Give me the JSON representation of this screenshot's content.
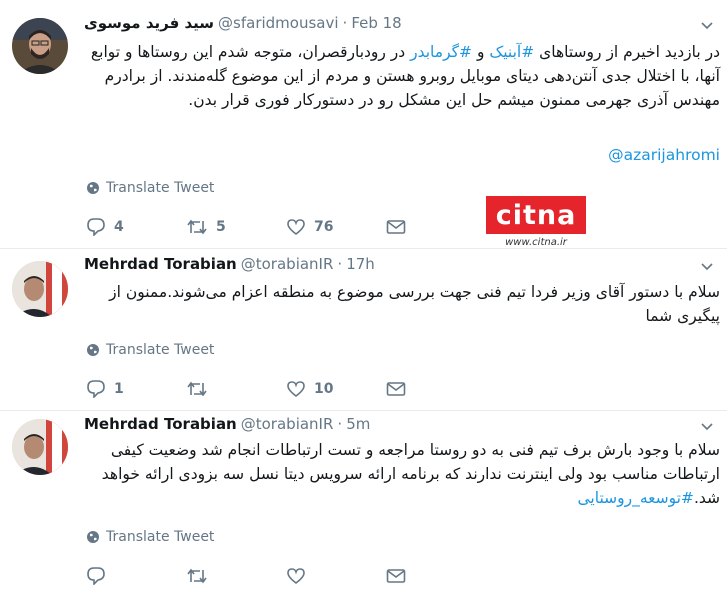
{
  "tweets": [
    {
      "name": "سید فرید موسوی",
      "handle": "@sfaridmousavi",
      "sep": "·",
      "time": "Feb 18",
      "text_parts": [
        {
          "t": "در بازدید اخیرم از روستاهای ",
          "k": "text"
        },
        {
          "t": "#آبنیک",
          "k": "ht"
        },
        {
          "t": " و ",
          "k": "text"
        },
        {
          "t": "#گرمابدر",
          "k": "ht"
        },
        {
          "t": " در رودبارقصران، متوجه شدم این روستاها و توابع آنها، با اختلال جدی آنتن‌دهی دیتای موبایل روبرو هستن و مردم از این موضوع گله‌مندند. از برادرم مهندس آذری جهرمی ممنون میشم حل این مشکل رو در دستورکار فوری قرار بدن.",
          "k": "text"
        }
      ],
      "mention": "@azarijahromi",
      "translate": "Translate Tweet",
      "replies": "4",
      "retweets": "5",
      "likes": "76"
    },
    {
      "name": "Mehrdad Torabian",
      "handle": "@torabianIR",
      "sep": "·",
      "time": "17h",
      "text": "سلام با دستور آقای وزیر فردا تیم فنی جهت بررسی موضوع به منطقه اعزام می‌شوند.ممنون از پیگیری شما",
      "translate": "Translate Tweet",
      "replies": "1",
      "retweets": "",
      "likes": "10"
    },
    {
      "name": "Mehrdad Torabian",
      "handle": "@torabianIR",
      "sep": "·",
      "time": "5m",
      "text": "سلام با وجود بارش برف تیم فنی به دو روستا مراجعه و تست ارتباطات انجام شد وضعیت کیفی ارتباطات مناسب بود ولی اینترنت ندارند که برنامه ارائه سرویس دیتا نسل سه بزودی ارائه خواهد شد.",
      "hashtag": "#توسعه_روستایی",
      "translate": "Translate Tweet",
      "replies": "",
      "retweets": "",
      "likes": ""
    }
  ],
  "watermark": {
    "brand": "citna",
    "url": "www.citna.ir",
    "color": "#e5242b"
  },
  "colors": {
    "link": "#1b95e0",
    "muted": "#657786",
    "text": "#14171a"
  }
}
